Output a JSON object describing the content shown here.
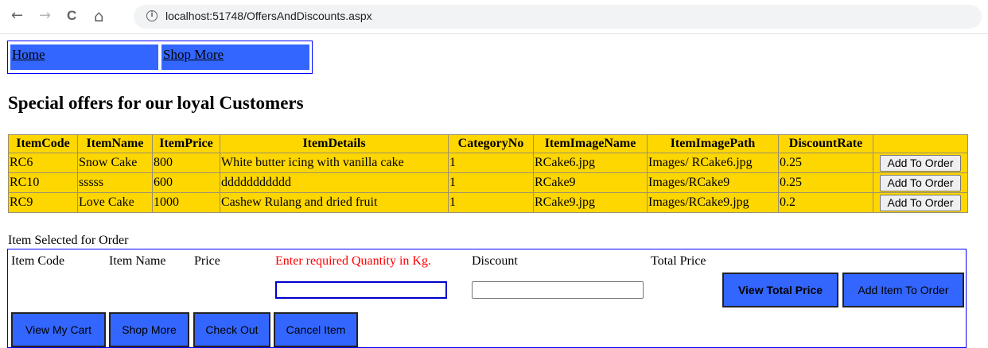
{
  "browser": {
    "back_icon": "←",
    "forward_icon": "→",
    "reload_icon": "C",
    "home_icon": "⌂",
    "info_icon": "i",
    "url": "localhost:51748/OffersAndDiscounts.aspx"
  },
  "menu": {
    "items": [
      {
        "label": "Home"
      },
      {
        "label": "Shop More"
      }
    ]
  },
  "page_title": "Special offers for our loyal Customers",
  "grid": {
    "headers": [
      "ItemCode",
      "ItemName",
      "ItemPrice",
      "ItemDetails",
      "CategoryNo",
      "ItemImageName",
      "ItemImagePath",
      "DiscountRate",
      ""
    ],
    "rows": [
      [
        "RC6",
        "Snow Cake",
        "800",
        "White butter icing with vanilla cake",
        "1",
        "RCake6.jpg",
        "Images/ RCake6.jpg",
        "0.25"
      ],
      [
        "RC10",
        "sssss",
        "600",
        "ddddddddddd",
        "1",
        "RCake9",
        "Images/RCake9",
        "0.25"
      ],
      [
        "RC9",
        "Love Cake",
        "1000",
        "Cashew Rulang and dried fruit",
        "1",
        "RCake9.jpg",
        "Images/RCake9.jpg",
        "0.2"
      ]
    ],
    "row_button_label": "Add To Order"
  },
  "order": {
    "section_label": "Item Selected for Order",
    "labels": {
      "item_code": "Item Code",
      "item_name": "Item Name",
      "price": "Price",
      "quantity": "Enter required Quantity in Kg.",
      "discount": "Discount",
      "total_price": "Total Price"
    },
    "quantity_value": "",
    "discount_value": "",
    "buttons": {
      "view_total_price": "View Total Price",
      "add_item_to_order": "Add Item To Order",
      "view_my_cart": "View My Cart",
      "shop_more": "Shop More",
      "check_out": "Check Out",
      "cancel_item": "Cancel Item"
    }
  },
  "colors": {
    "grid_background": "#ffd700",
    "button_blue": "#3366ff",
    "panel_border": "#0000ff",
    "highlight_label": "#ff0000"
  }
}
